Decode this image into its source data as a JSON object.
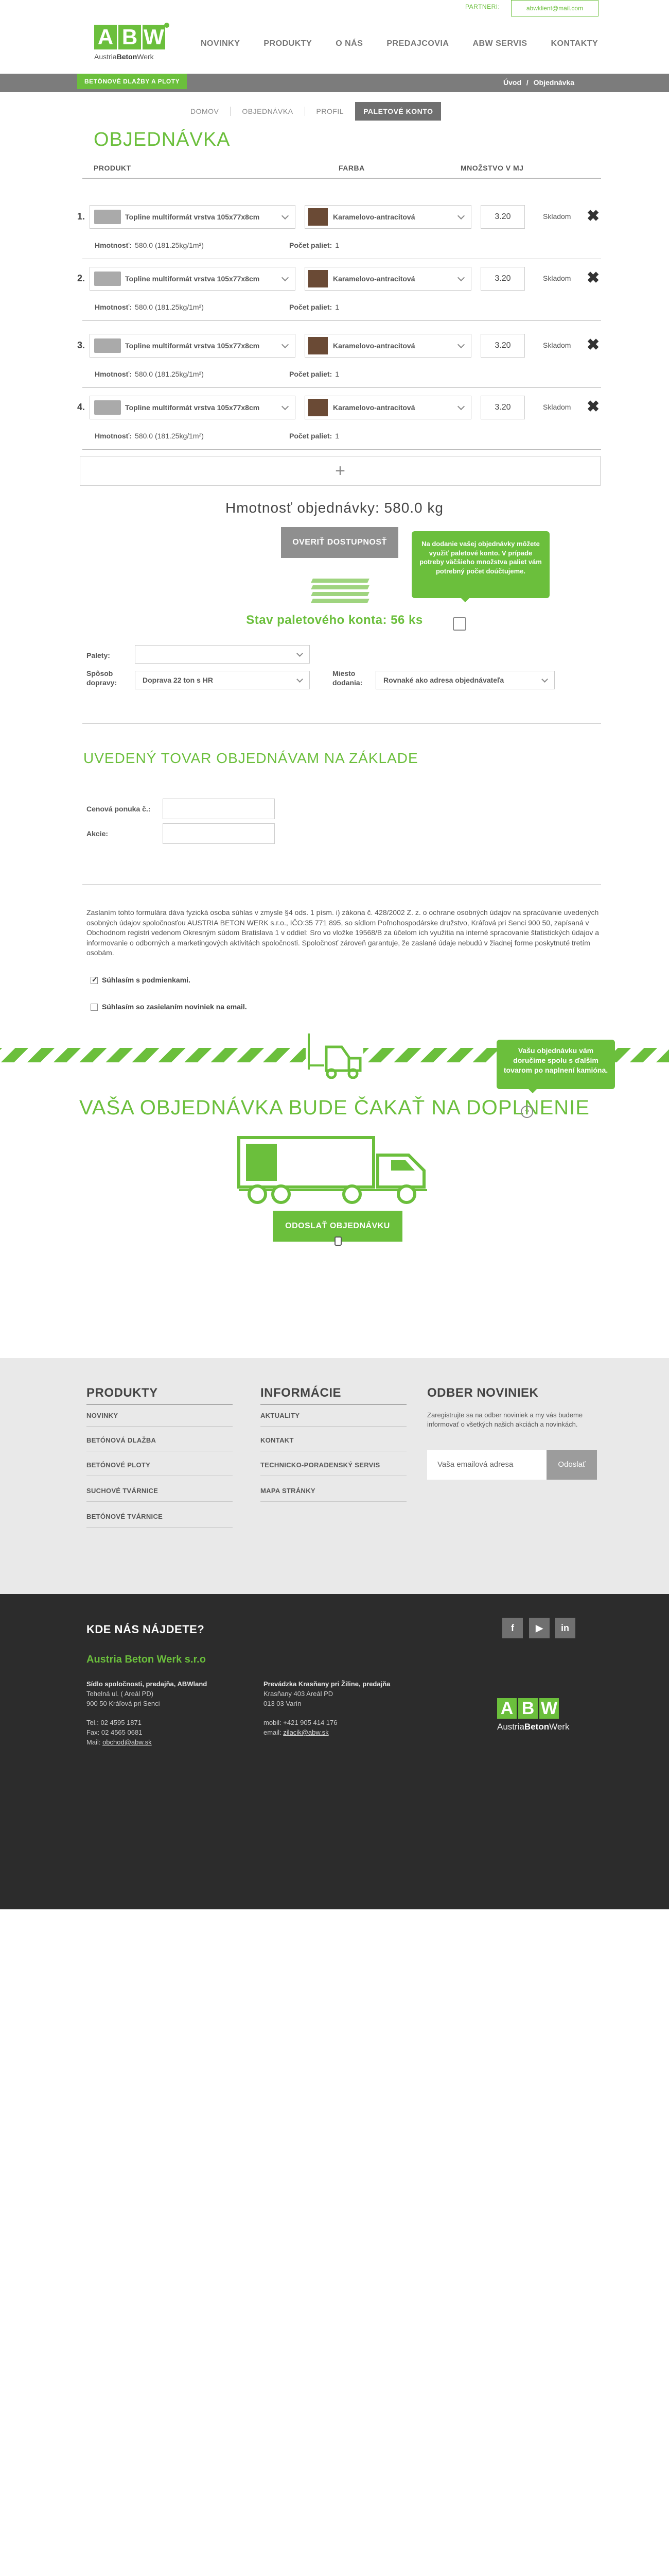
{
  "topbar": {
    "partner_label": "PARTNERI:",
    "email": "abwklient@mail.com"
  },
  "logo": {
    "letters": [
      "A",
      "B",
      "W"
    ],
    "sub_a": "Austria",
    "sub_b": "Beton",
    "sub_c": "Werk"
  },
  "nav": [
    "NOVINKY",
    "PRODUKTY",
    "O NÁS",
    "PREDAJCOVIA",
    "ABW SERVIS",
    "KONTAKTY"
  ],
  "section_tab": "BETÓNOVÉ DLAŽBY A PLOTY",
  "breadcrumb": {
    "home": "Úvod",
    "sep": "/",
    "current": "Objednávka"
  },
  "steps": [
    "DOMOV",
    "OBJEDNÁVKA",
    "PROFIL",
    "PALETOVÉ KONTO"
  ],
  "page_title": "OBJEDNÁVKA",
  "columns": {
    "product": "PRODUKT",
    "color": "FARBA",
    "qty": "MNOŽSTVO V MJ"
  },
  "rows": [
    {
      "num": "1.",
      "product": "Topline multiformát vrstva 105x77x8cm",
      "color": "Karamelovo-antracitová",
      "qty": "3.20",
      "stock": "Skladom",
      "weight_label": "Hmotnosť:",
      "weight": "580.0  (181.25kg/1m²)",
      "pallets_label": "Počet paliet:",
      "pallets": "1"
    },
    {
      "num": "2.",
      "product": "Topline multiformát vrstva 105x77x8cm",
      "color": "Karamelovo-antracitová",
      "qty": "3.20",
      "stock": "Skladom",
      "weight_label": "Hmotnosť:",
      "weight": "580.0  (181.25kg/1m²)",
      "pallets_label": "Počet paliet:",
      "pallets": "1"
    },
    {
      "num": "3.",
      "product": "Topline multiformát vrstva 105x77x8cm",
      "color": "Karamelovo-antracitová",
      "qty": "3.20",
      "stock": "Skladom",
      "weight_label": "Hmotnosť:",
      "weight": "580.0  (181.25kg/1m²)",
      "pallets_label": "Počet paliet:",
      "pallets": "1"
    },
    {
      "num": "4.",
      "product": "Topline multiformát vrstva 105x77x8cm",
      "color": "Karamelovo-antracitová",
      "qty": "3.20",
      "stock": "Skladom",
      "weight_label": "Hmotnosť:",
      "weight": "580.0  (181.25kg/1m²)",
      "pallets_label": "Počet paliet:",
      "pallets": "1"
    }
  ],
  "add_row": "+",
  "order_weight": "Hmotnosť objednávky: 580.0 kg",
  "verify_button": "OVERIŤ DOSTUPNOSŤ",
  "tooltip_pallets": "Na dodanie vašej objednávky môžete využiť paletové konto. V prípade potreby väčšieho množstva paliet vám potrebný počet doúčtujeme.",
  "pallet_status": "Stav paletového konta: 56 ks",
  "form": {
    "pallets_label": "Palety:",
    "pallets_value": "",
    "transport_label_1": "Spôsob",
    "transport_label_2": "dopravy:",
    "transport_value": "Doprava 22 ton s HR",
    "place_label_1": "Miesto",
    "place_label_2": "dodania:",
    "place_value": "Rovnaké ako adresa objednávateľa"
  },
  "basis_title": "UVEDENÝ TOVAR OBJEDNÁVAM NA ZÁKLADE",
  "basis": {
    "quote_label": "Cenová ponuka č.:",
    "quote_value": "",
    "action_label": "Akcie:",
    "action_value": ""
  },
  "legal": "Zaslaním tohto formulára dáva fyzická osoba súhlas v zmysle §4 ods. 1 písm. i) zákona č. 428/2002 Z. z. o ochrane osobných údajov na spracúvanie uvedených osobných údajov spoločnosťou AUSTRIA BETON WERK s.r.o., IČO:35 771 895, so sídlom Poľnohospodárske družstvo, Kráľová pri Senci 900 50, zapísaná v Obchodnom registri vedenom Okresným súdom Bratislava 1 v oddiel: Sro vo vložke 19568/B za účelom ich využitia na interné spracovanie štatistických údajov a informovanie o odborných a marketingových aktivitách spoločnosti. Spoločnosť zároveň garantuje, že zaslané údaje nebudú v žiadnej forme poskytnuté tretím osobám.",
  "consent_terms": "Súhlasím s podmienkami.",
  "consent_news": "Súhlasím so zasielaním noviniek na email.",
  "tooltip_wait": "Vašu objednávku vám doručíme spolu s ďalším tovarom po naplnení kamióna.",
  "wait_title": "VAŠA OBJEDNÁVKA BUDE ČAKAŤ NA DOPLNENIE",
  "wait_help": "?",
  "send_button": "ODOSLAŤ OBJEDNÁVKU",
  "footer": {
    "products_title": "PRODUKTY",
    "products": [
      "NOVINKY",
      "BETÓNOVÁ DLAŽBA",
      "BETÓNOVÉ PLOTY",
      "SUCHOVÉ TVÁRNICE",
      "BETÓNOVÉ TVÁRNICE"
    ],
    "info_title": "INFORMÁCIE",
    "info": [
      "AKTUALITY",
      "KONTAKT",
      "TECHNICKO-PORADENSKÝ SERVIS",
      "MAPA STRÁNKY"
    ],
    "news_title": "ODBER NOVINIEK",
    "news_text": "Zaregistrujte sa na odber noviniek a my vás budeme informovať o všetkých našich akciách a novinkách.",
    "news_placeholder": "Vaša emailová adresa",
    "news_button": "Odoslať"
  },
  "contact": {
    "title": "KDE NÁS NÁJDETE?",
    "company": "Austria Beton Werk s.r.o",
    "hq_title": "Sídlo spoločnosti, predajňa, ABWland",
    "hq_line1": "Tehelná ul. ( Areál PD)",
    "hq_line2": "900 50 Kráľová pri Senci",
    "tel": "Tel.: 02 4595 1871",
    "fax": "Fax: 02 4565 0681",
    "mail_label": "Mail: ",
    "mail": "obchod@abw.sk",
    "branch_title": "Prevádzka Krasňany pri Žiline, predajňa",
    "branch_line1": "Krasňany 403 Areál PD",
    "branch_line2": "013 03 Varín",
    "mobile": "mobil: +421 905 414 176",
    "email_label": "email: ",
    "email": "zilacik@abw.sk",
    "social": [
      "f",
      "▶",
      "in"
    ]
  }
}
